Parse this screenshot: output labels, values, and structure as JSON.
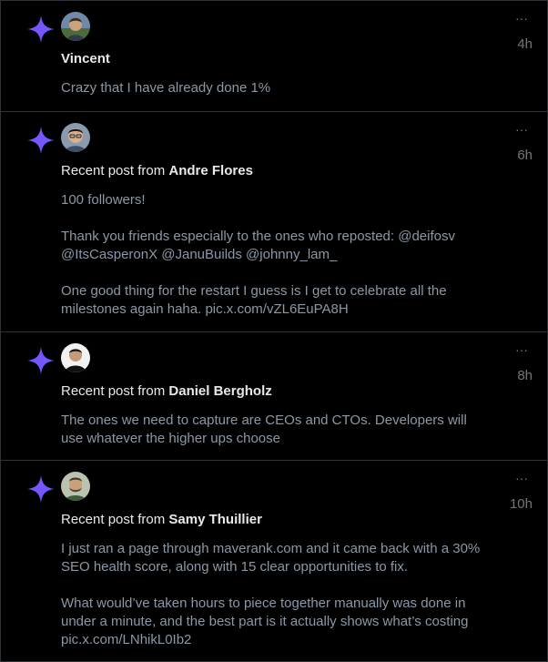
{
  "colors": {
    "background": "#000000",
    "border": "#2f3336",
    "sparkle": "#7856ff",
    "primary_text": "#e7e9ea",
    "secondary_text": "#8b98a5",
    "muted": "#71767b"
  },
  "notifications": [
    {
      "icon": "sparkle-icon",
      "prefix": "",
      "user": "Vincent",
      "time": "4h",
      "more": "···",
      "paragraphs": [
        "Crazy that I have already done 1%"
      ]
    },
    {
      "icon": "sparkle-icon",
      "prefix": "Recent post from ",
      "user": "Andre Flores",
      "time": "6h",
      "more": "···",
      "paragraphs": [
        "100 followers!",
        "Thank you friends especially to the ones who reposted: @deifosv @ItsCasperonX @JanuBuilds @johnny_lam_",
        "One good thing for the restart I guess is I get to celebrate all the milestones again haha. pic.x.com/vZL6EuPA8H"
      ]
    },
    {
      "icon": "sparkle-icon",
      "prefix": "Recent post from ",
      "user": "Daniel Bergholz",
      "time": "8h",
      "more": "···",
      "paragraphs": [
        "The ones we need to capture are CEOs and CTOs. Developers will use whatever the higher ups choose"
      ]
    },
    {
      "icon": "sparkle-icon",
      "prefix": "Recent post from ",
      "user": "Samy Thuillier",
      "time": "10h",
      "more": "···",
      "paragraphs": [
        "I just ran a page through maverank.com and it came back with a 30% SEO health score, along with 15 clear opportunities to fix.",
        "What would’ve taken hours to piece together manually was done in under a minute, and the best part is it actually shows what’s costing pic.x.com/LNhikL0Ib2"
      ]
    }
  ]
}
